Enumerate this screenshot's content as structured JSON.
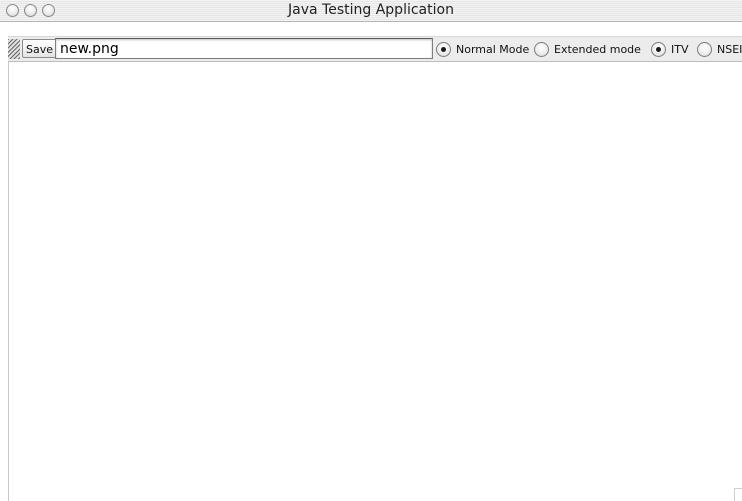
{
  "window": {
    "title": "Java Testing Application",
    "buttons": [
      "close-icon",
      "minimize-icon",
      "zoom-icon"
    ]
  },
  "toolbar": {
    "save_label": "Save",
    "filename_value": "new.png",
    "radio_groups": [
      {
        "options": [
          {
            "label": "Normal Mode",
            "checked": true
          },
          {
            "label": "Extended mode",
            "checked": false
          }
        ]
      },
      {
        "options": [
          {
            "label": "ITV",
            "checked": true
          },
          {
            "label": "NSEI",
            "checked": false
          }
        ]
      }
    ]
  }
}
